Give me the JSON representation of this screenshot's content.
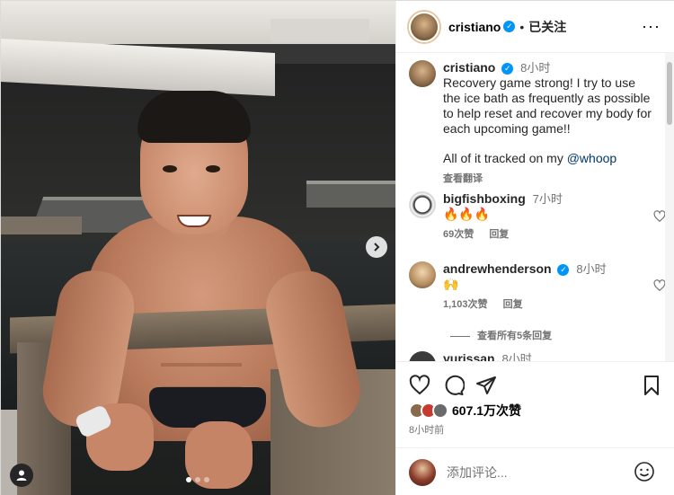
{
  "post": {
    "author": "cristiano",
    "follow_status": "已关注",
    "separator": "•",
    "more_glyph": "···",
    "caption": {
      "user": "cristiano",
      "time": "8小时",
      "text": "Recovery game strong! I try to use the ice bath as frequently as possible to help reset and recover my body for each upcoming game!!",
      "text2_prefix": "All of it tracked on my ",
      "mention": "@whoop",
      "translate": "查看翻译"
    },
    "likes": "607.1万次赞",
    "posted": "8小时前",
    "carousel": {
      "total": 3,
      "active": 0
    }
  },
  "comments": [
    {
      "user": "bigfishboxing",
      "time": "7小时",
      "text": "🔥🔥🔥",
      "likes": "69次赞",
      "reply": "回复",
      "verified": false
    },
    {
      "user": "andrewhenderson",
      "time": "8小时",
      "text": "🙌",
      "likes": "1,103次赞",
      "reply": "回复",
      "verified": true
    },
    {
      "user": "yurissan",
      "time": "8小时"
    }
  ],
  "view_replies": "查看所有5条回复",
  "composer": {
    "placeholder": "添加评论..."
  },
  "colors": {
    "verified": "#0095f6",
    "mention": "#00376b",
    "secondary": "#737373"
  },
  "icons": [
    "verified-badge-icon",
    "more-icon",
    "heart-icon",
    "comment-icon",
    "share-icon",
    "bookmark-icon",
    "chevron-right-icon",
    "user-tag-icon",
    "emoji-icon"
  ]
}
